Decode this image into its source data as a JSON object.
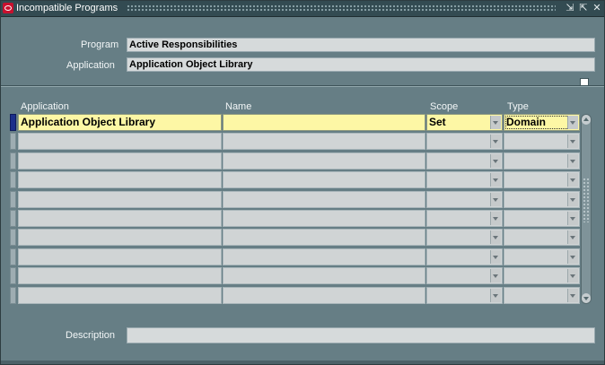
{
  "window": {
    "title": "Incompatible Programs",
    "app_icon": "oracle-icon",
    "controls": [
      "minimize-icon",
      "maximize-icon",
      "close-icon"
    ],
    "controls_glyphs": [
      "⇲",
      "⇱",
      "✕"
    ]
  },
  "header": {
    "program_label": "Program",
    "program_value": "Active Responsibilities",
    "application_label": "Application",
    "application_value": "Application Object Library"
  },
  "table": {
    "columns": [
      "Application",
      "Name",
      "Scope",
      "Type"
    ],
    "rows": [
      {
        "application": "Application Object Library",
        "name": "",
        "scope": "Set",
        "type": "Domain"
      },
      {
        "application": "",
        "name": "",
        "scope": "",
        "type": ""
      },
      {
        "application": "",
        "name": "",
        "scope": "",
        "type": ""
      },
      {
        "application": "",
        "name": "",
        "scope": "",
        "type": ""
      },
      {
        "application": "",
        "name": "",
        "scope": "",
        "type": ""
      },
      {
        "application": "",
        "name": "",
        "scope": "",
        "type": ""
      },
      {
        "application": "",
        "name": "",
        "scope": "",
        "type": ""
      },
      {
        "application": "",
        "name": "",
        "scope": "",
        "type": ""
      },
      {
        "application": "",
        "name": "",
        "scope": "",
        "type": ""
      },
      {
        "application": "",
        "name": "",
        "scope": "",
        "type": ""
      }
    ]
  },
  "footer": {
    "description_label": "Description",
    "description_value": ""
  },
  "colors": {
    "background": "#667e85",
    "titlebar": "#334b52",
    "current_record": "#fdf7a5",
    "active_indicator": "#1b2f8a"
  }
}
